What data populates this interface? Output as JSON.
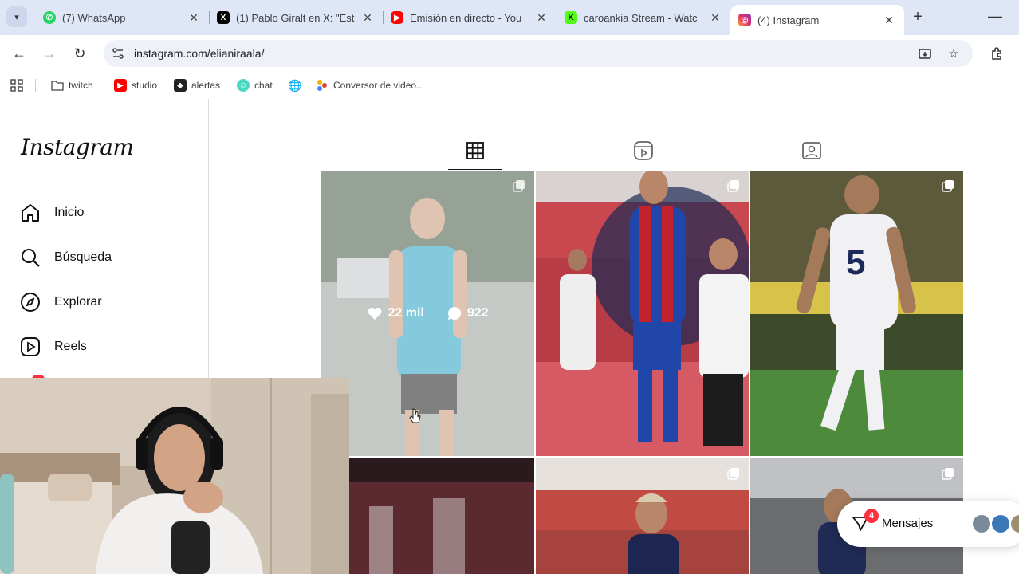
{
  "browser": {
    "tabs": [
      {
        "title": "(7) WhatsApp",
        "favicon": "whatsapp-icon",
        "color": "#25d366"
      },
      {
        "title": "(1) Pablo Giralt en X: \"Est",
        "favicon": "x-icon",
        "color": "#000000"
      },
      {
        "title": "Emisión en directo - You",
        "favicon": "youtube-icon",
        "color": "#ff0000"
      },
      {
        "title": "caroankia Stream - Watc",
        "favicon": "kick-icon",
        "color": "#53fc18"
      },
      {
        "title": "(4) Instagram",
        "favicon": "instagram-icon",
        "color": "#e1306c"
      }
    ],
    "active_tab": 4,
    "url": "instagram.com/elianiraala/",
    "bookmarks": [
      {
        "label": "twitch",
        "icon": "folder-icon"
      },
      {
        "label": "studio",
        "icon": "youtube-studio-icon"
      },
      {
        "label": "alertas",
        "icon": "alerts-icon"
      },
      {
        "label": "chat",
        "icon": "chat-icon"
      },
      {
        "label": "",
        "icon": "globe-icon"
      },
      {
        "label": "Conversor de video...",
        "icon": "converter-icon"
      }
    ]
  },
  "instagram": {
    "logo": "Instagram",
    "nav": [
      {
        "label": "Inicio",
        "icon": "home-icon"
      },
      {
        "label": "Búsqueda",
        "icon": "search-icon"
      },
      {
        "label": "Explorar",
        "icon": "compass-icon"
      },
      {
        "label": "Reels",
        "icon": "reels-icon"
      }
    ],
    "profile_tabs": [
      "grid-icon",
      "reels-tab-icon",
      "tagged-icon"
    ],
    "hover_post": {
      "likes": "22 mil",
      "comments": "922"
    },
    "messages": {
      "label": "Mensajes",
      "badge": "4"
    }
  },
  "colors": {
    "accent": "#0095f6",
    "badge": "#ff3040",
    "tabstrip": "#dfe6f5"
  }
}
